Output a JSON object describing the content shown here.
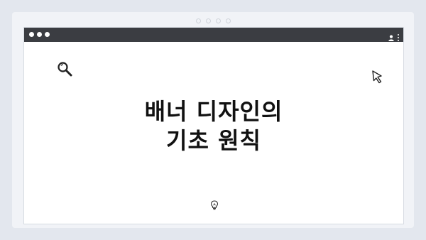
{
  "window": {
    "controls": [
      "close",
      "minimize",
      "maximize"
    ],
    "toolbar_icons": [
      "user-icon",
      "more-vertical-icon"
    ]
  },
  "content": {
    "title_line1": "배너 디자인의",
    "title_line2": "기초 원칙",
    "icons": [
      "search-icon",
      "cursor-arrow-icon",
      "lightbulb-icon"
    ]
  },
  "colors": {
    "background": "#e3e7ee",
    "frame": "#f1f3f7",
    "titlebar": "#3b3d42",
    "canvas": "#ffffff",
    "text": "#111111"
  }
}
